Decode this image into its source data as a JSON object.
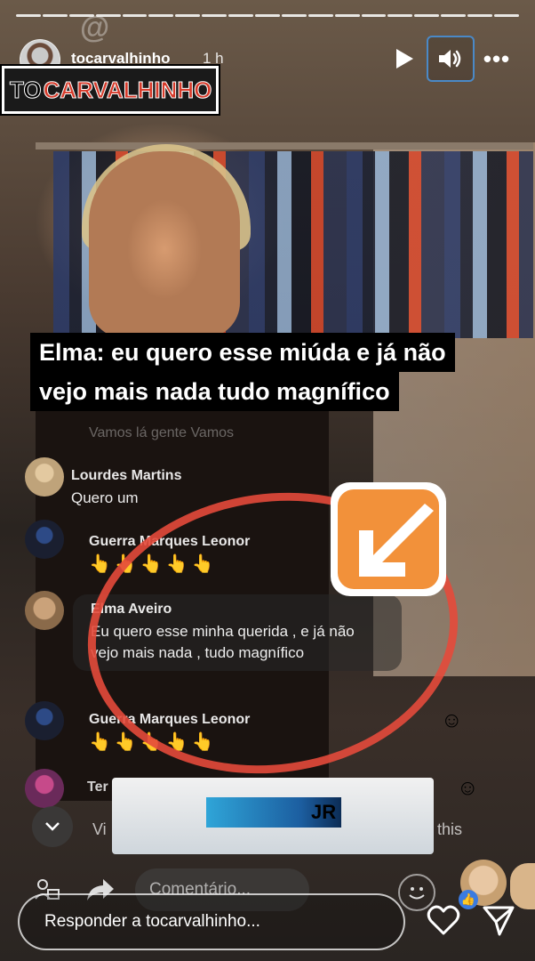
{
  "story": {
    "username": "tocarvalhinho",
    "time_ago": "1 h",
    "watermark_symbol": "@",
    "logo": {
      "prefix": "TO",
      "name": "CARVALHINHO"
    },
    "more_label": "•••"
  },
  "caption": {
    "line1": "Elma: eu quero esse miúda e já não",
    "line2": "vejo mais nada tudo magnífico"
  },
  "comments": {
    "faint": "Vamos lá gente Vamos",
    "items": [
      {
        "name": "Lourdes Martins",
        "text": "Quero um"
      },
      {
        "name": "Guerra Marques Leonor",
        "text": "👆👆👆👆👆"
      },
      {
        "name": "Elma Aveiro",
        "text": "Eu quero esse minha querida , e já não vejo mais nada , tudo magnífico"
      },
      {
        "name": "Guerra Marques Leonor",
        "text": "👆👆👆👆👆"
      }
    ],
    "partial_name": "Ter",
    "input_prefix": "Vi",
    "input_suffix": "this"
  },
  "live_ui": {
    "comment_placeholder": "Comentário...",
    "banner_mark": "JR"
  },
  "footer": {
    "reply_placeholder": "Responder a tocarvalhinho..."
  },
  "colors": {
    "annotation_red": "#e44a3b",
    "arrow_orange": "#f2913a",
    "active_outline": "#4a89c7"
  }
}
